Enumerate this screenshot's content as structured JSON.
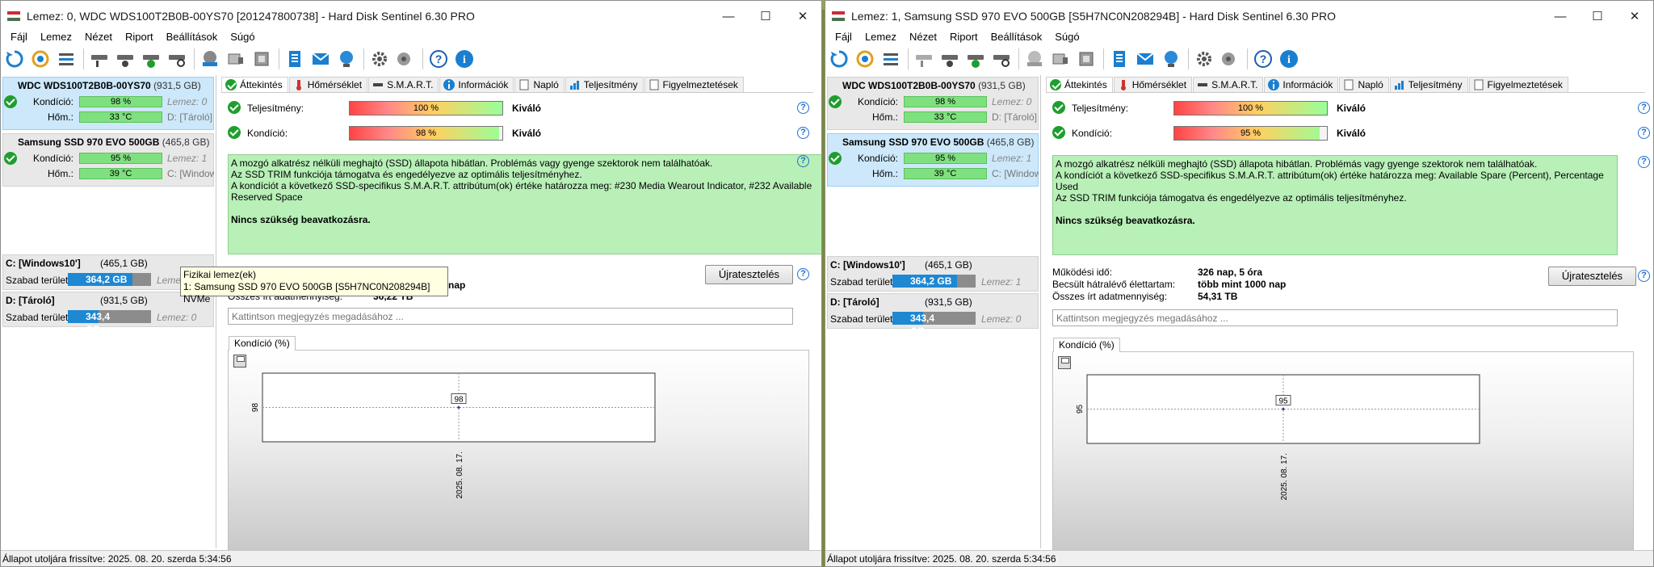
{
  "colors": {
    "ok_green": "#1f9e2f",
    "bar_green": "#7fe07f",
    "volume_blue": "#1e88d2",
    "info_bg": "#b8f0b8",
    "selected_bg": "#cce8fa"
  },
  "windows": [
    {
      "title": "Lemez: 0, WDC  WDS100T2B0B-00YS70 [201247800738]  -  Hard Disk Sentinel 6.30 PRO",
      "menu": [
        "Fájl",
        "Lemez",
        "Nézet",
        "Riport",
        "Beállítások",
        "Súgó"
      ],
      "disks": [
        {
          "name": "WDC  WDS100T2B0B-00YS70",
          "size": "(931,5 GB)",
          "health_label": "Kondíció:",
          "health": "98 %",
          "health_extra": "Lemez: 0",
          "temp_label": "Hőm.:",
          "temp": "33 °C",
          "temp_extra": "D: [Tároló]"
        },
        {
          "name": "Samsung SSD 970 EVO 500GB",
          "size": "(465,8 GB)",
          "health_label": "Kondíció:",
          "health": "95 %",
          "health_extra": "Lemez: 1",
          "temp_label": "Hőm.:",
          "temp": "39 °C",
          "temp_extra": "C: [Windows10']"
        }
      ],
      "volumes": [
        {
          "name": "C: [Windows10']",
          "size": "(465,1 GB)",
          "free_label": "Szabad terület",
          "free": "364,2 GB",
          "fill": 0.78,
          "disk": "Lemez: 1"
        },
        {
          "name": "D: [Tároló]",
          "size": "(931,5 GB)",
          "free_label": "Szabad terület",
          "free": "343,4 GB",
          "fill": 0.37,
          "disk": "Lemez: 0"
        }
      ],
      "tabs": [
        "Áttekintés",
        "Hőmérséklet",
        "S.M.A.R.T.",
        "Információk",
        "Napló",
        "Teljesítmény",
        "Figyelmeztetések"
      ],
      "performance": {
        "label": "Teljesítmény:",
        "value": "100 %",
        "fraction": 1.0,
        "rating": "Kiváló"
      },
      "condition": {
        "label": "Kondíció:",
        "value": "98 %",
        "fraction": 0.98,
        "rating": "Kiváló"
      },
      "info_lines": [
        "A mozgó alkatrész nélküli meghajtó (SSD) állapota hibátlan. Problémás vagy gyenge szektorok nem találhatóak.",
        "Az SSD TRIM funkciója támogatva és engedélyezve az optimális teljesítményhez.",
        "A kondíciót a következő SSD-specifikus S.M.A.R.T. attribútum(ok) értéke határozza meg: #230 Media Wearout Indicator, #232 Available Reserved Space"
      ],
      "verdict": "Nincs szükség beavatkozásra.",
      "retest_label": "Újratesztelés",
      "stats": [
        {
          "label": "Működési idő:",
          "value": ""
        },
        {
          "label": "Becsült hátralévő élettartam:",
          "value": "nap"
        },
        {
          "label": "Összes írt adatmennyiség:",
          "value": "36,22 TB"
        }
      ],
      "note_placeholder": "Kattintson megjegyzés megadásához ...",
      "chart_tab": "Kondíció  (%)",
      "chart_data": {
        "type": "line",
        "x": [
          "2025. 08. 17."
        ],
        "values": [
          98
        ],
        "ylabel": "98",
        "title": "Kondíció  (%)"
      },
      "status": "Állapot utoljára frissítve: 2025. 08. 20. szerda 5:34:56",
      "tooltip": {
        "title": "Fizikai lemez(ek)",
        "line": "1: Samsung SSD 970 EVO 500GB [S5H7NC0N208294B] NVMe"
      }
    },
    {
      "title": "Lemez: 1, Samsung SSD 970 EVO 500GB [S5H7NC0N208294B]  -  Hard Disk Sentinel 6.30 PRO",
      "menu": [
        "Fájl",
        "Lemez",
        "Nézet",
        "Riport",
        "Beállítások",
        "Súgó"
      ],
      "disks": [
        {
          "name": "WDC  WDS100T2B0B-00YS70",
          "size": "(931,5 GB)",
          "health_label": "Kondíció:",
          "health": "98 %",
          "health_extra": "Lemez: 0",
          "temp_label": "Hőm.:",
          "temp": "33 °C",
          "temp_extra": "D: [Tároló]"
        },
        {
          "name": "Samsung SSD 970 EVO 500GB",
          "size": "(465,8 GB)",
          "health_label": "Kondíció:",
          "health": "95 %",
          "health_extra": "Lemez: 1",
          "temp_label": "Hőm.:",
          "temp": "39 °C",
          "temp_extra": "C: [Windows10']"
        }
      ],
      "volumes": [
        {
          "name": "C: [Windows10']",
          "size": "(465,1 GB)",
          "free_label": "Szabad terület",
          "free": "364,2 GB",
          "fill": 0.78,
          "disk": "Lemez: 1"
        },
        {
          "name": "D: [Tároló]",
          "size": "(931,5 GB)",
          "free_label": "Szabad terület",
          "free": "343,4 GB",
          "fill": 0.37,
          "disk": "Lemez: 0"
        }
      ],
      "tabs": [
        "Áttekintés",
        "Hőmérséklet",
        "S.M.A.R.T.",
        "Információk",
        "Napló",
        "Teljesítmény",
        "Figyelmeztetések"
      ],
      "performance": {
        "label": "Teljesítmény:",
        "value": "100 %",
        "fraction": 1.0,
        "rating": "Kiváló"
      },
      "condition": {
        "label": "Kondíció:",
        "value": "95 %",
        "fraction": 0.95,
        "rating": "Kiváló"
      },
      "info_lines": [
        "A mozgó alkatrész nélküli meghajtó (SSD) állapota hibátlan. Problémás vagy gyenge szektorok nem találhatóak.",
        "A kondíciót a következő SSD-specifikus S.M.A.R.T. attribútum(ok) értéke határozza meg:  Available Spare (Percent), Percentage Used",
        "Az SSD TRIM funkciója támogatva és engedélyezve az optimális teljesítményhez."
      ],
      "verdict": "Nincs szükség beavatkozásra.",
      "retest_label": "Újratesztelés",
      "stats": [
        {
          "label": "Működési idő:",
          "value": "326 nap, 5 óra"
        },
        {
          "label": "Becsült hátralévő élettartam:",
          "value": "több mint 1000 nap"
        },
        {
          "label": "Összes írt adatmennyiség:",
          "value": "54,31 TB"
        }
      ],
      "note_placeholder": "Kattintson megjegyzés megadásához ...",
      "chart_tab": "Kondíció  (%)",
      "chart_data": {
        "type": "line",
        "x": [
          "2025. 08. 17."
        ],
        "values": [
          95
        ],
        "ylabel": "95",
        "title": "Kondíció  (%)"
      },
      "status": "Állapot utoljára frissítve: 2025. 08. 20. szerda 5:34:56"
    }
  ]
}
